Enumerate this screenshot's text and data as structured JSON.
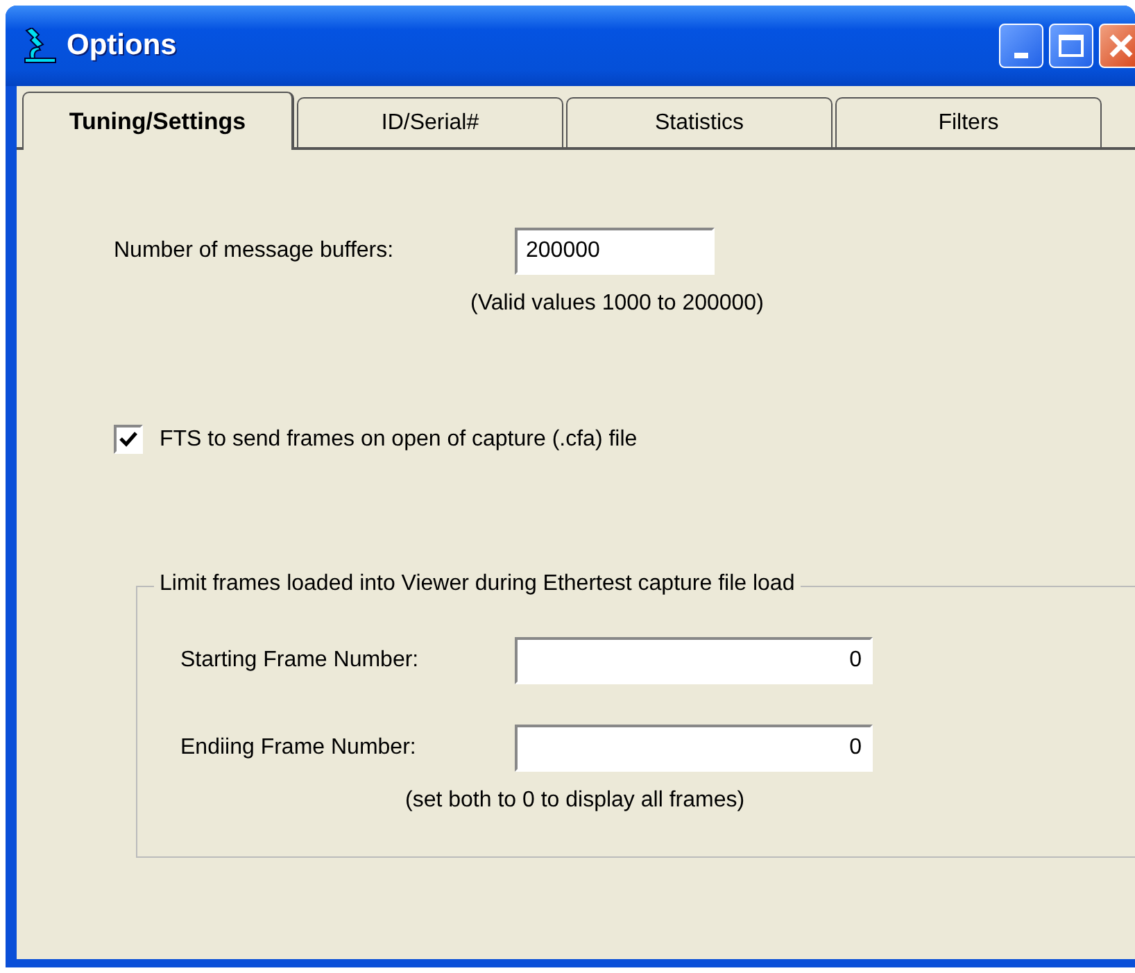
{
  "window": {
    "title": "Options"
  },
  "tabs": [
    {
      "label": "Tuning/Settings",
      "selected": true
    },
    {
      "label": "ID/Serial#",
      "selected": false
    },
    {
      "label": "Statistics",
      "selected": false
    },
    {
      "label": "Filters",
      "selected": false
    }
  ],
  "buffers": {
    "label": "Number of message buffers:",
    "value": "200000",
    "hint": "(Valid values 1000 to 200000)"
  },
  "send_frames": {
    "label": "FTS to send frames on open of capture (.cfa) file",
    "checked": true
  },
  "limit_group": {
    "title": "Limit frames loaded into Viewer during Ethertest capture file load",
    "fields": [
      {
        "label": "Starting Frame Number:",
        "value": "0"
      },
      {
        "label": "Endiing Frame Number:",
        "value": "0"
      }
    ],
    "hint": "(set both to 0 to display all frames)"
  }
}
